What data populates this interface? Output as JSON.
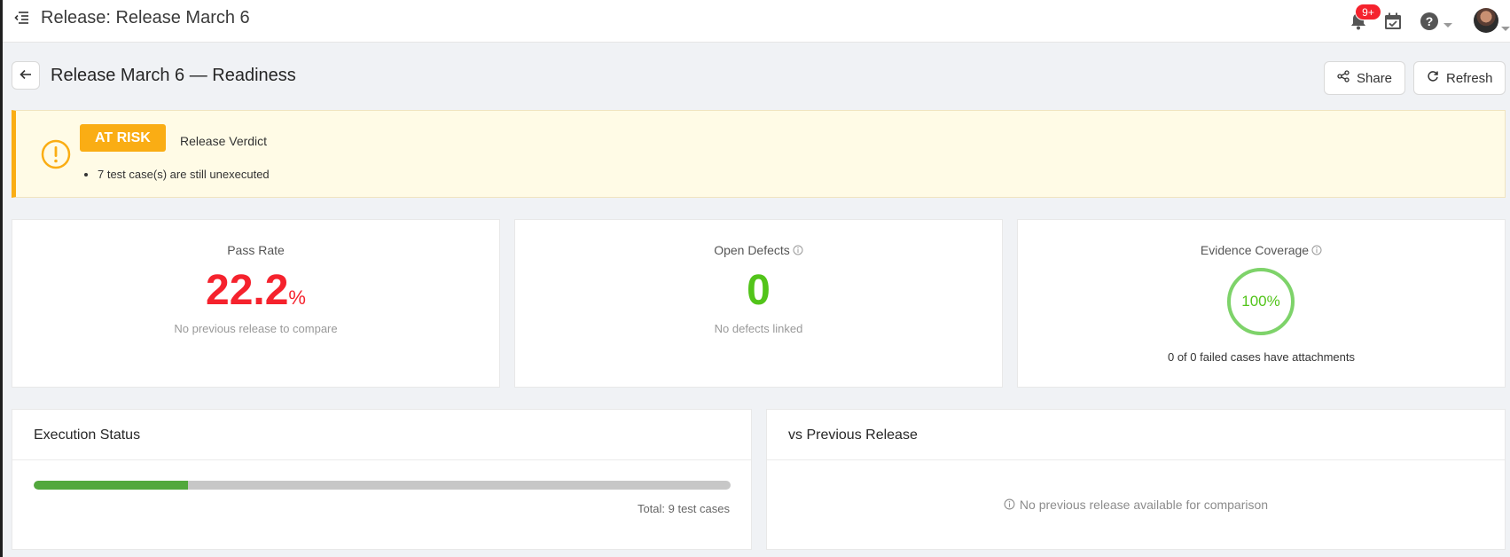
{
  "header": {
    "title": "Release: Release March 6",
    "notification_badge": "9+"
  },
  "page": {
    "title": "Release March 6 — Readiness",
    "share_label": "Share",
    "refresh_label": "Refresh"
  },
  "verdict": {
    "status": "AT RISK",
    "label": "Release Verdict",
    "reasons": [
      "7 test case(s) are still unexecuted"
    ],
    "accent_color": "#faad14"
  },
  "stats": {
    "pass_rate": {
      "title": "Pass Rate",
      "value": "22.2",
      "unit": "%",
      "subtitle": "No previous release to compare",
      "color": "#f5222d"
    },
    "open_defects": {
      "title": "Open Defects",
      "value": "0",
      "subtitle": "No defects linked",
      "color": "#52c41a"
    },
    "evidence": {
      "title": "Evidence Coverage",
      "value": "100%",
      "fraction": 1.0,
      "subtitle": "0 of 0 failed cases have attachments",
      "color": "#52c41a"
    }
  },
  "execution": {
    "title": "Execution Status",
    "passed_fraction": 0.222,
    "total_label": "Total: 9 test cases"
  },
  "comparison": {
    "title": "vs Previous Release",
    "empty_message": "No previous release available for comparison"
  },
  "icons": [
    "menu-fold-icon",
    "bell-icon",
    "calendar-check-icon",
    "help-icon",
    "arrow-left-icon",
    "share-icon",
    "reload-icon",
    "exclamation-circle-icon",
    "info-circle-icon"
  ]
}
